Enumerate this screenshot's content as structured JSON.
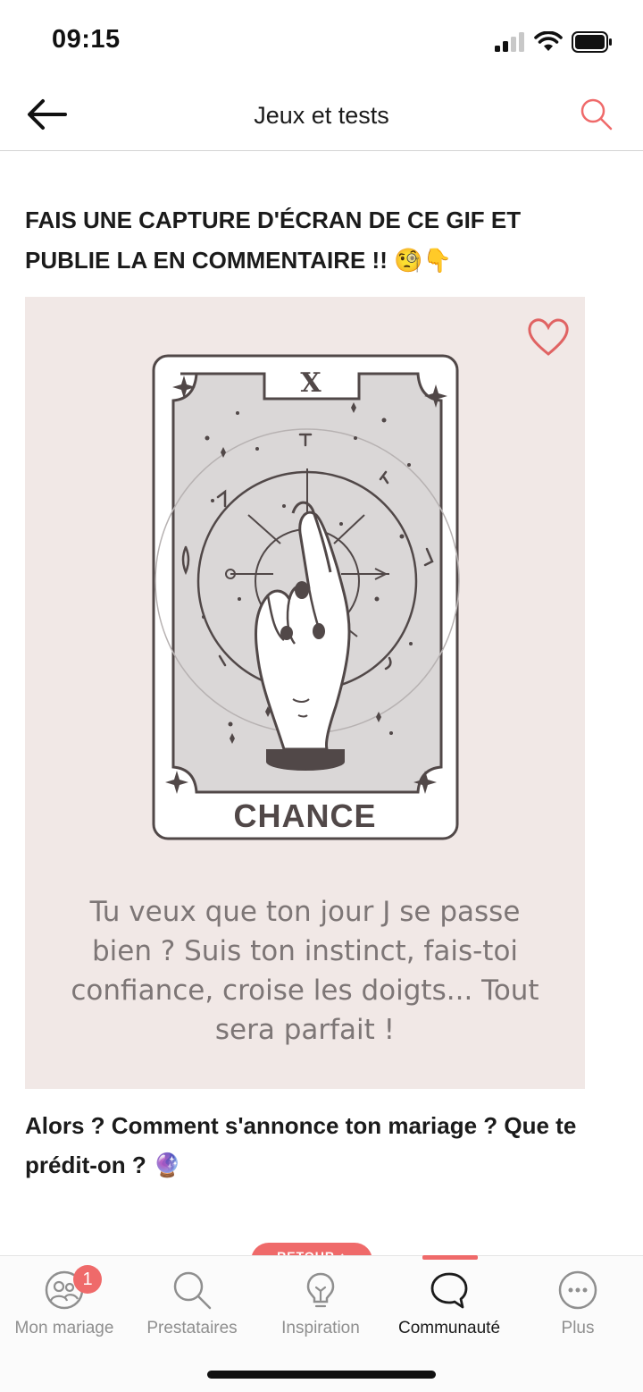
{
  "status": {
    "time": "09:15"
  },
  "header": {
    "title": "Jeux et tests"
  },
  "post": {
    "title": "FAIS UNE CAPTURE D'ÉCRAN DE CE GIF ET PUBLIE LA EN COMMENTAIRE !! 🧐👇",
    "card": {
      "numeral": "X",
      "name": "CHANCE",
      "caption": "Tu veux que ton jour J se passe bien ? Suis ton instinct, fais-toi confiance, croise les doigts... Tout sera parfait !"
    },
    "question": "Alors ? Comment s'annonce ton mariage ? Que te prédit-on ? 🔮"
  },
  "return_pill": {
    "label": "RETOUR ↑"
  },
  "tabs": [
    {
      "label": "Mon mariage",
      "icon": "people-icon",
      "badge": "1"
    },
    {
      "label": "Prestataires",
      "icon": "search-icon"
    },
    {
      "label": "Inspiration",
      "icon": "lightbulb-icon"
    },
    {
      "label": "Communauté",
      "icon": "chat-bubble-icon",
      "active": true
    },
    {
      "label": "Plus",
      "icon": "more-icon"
    }
  ],
  "colors": {
    "accent": "#ef6a6a",
    "card_bg": "#f1e8e6",
    "card_ink": "#514848"
  }
}
